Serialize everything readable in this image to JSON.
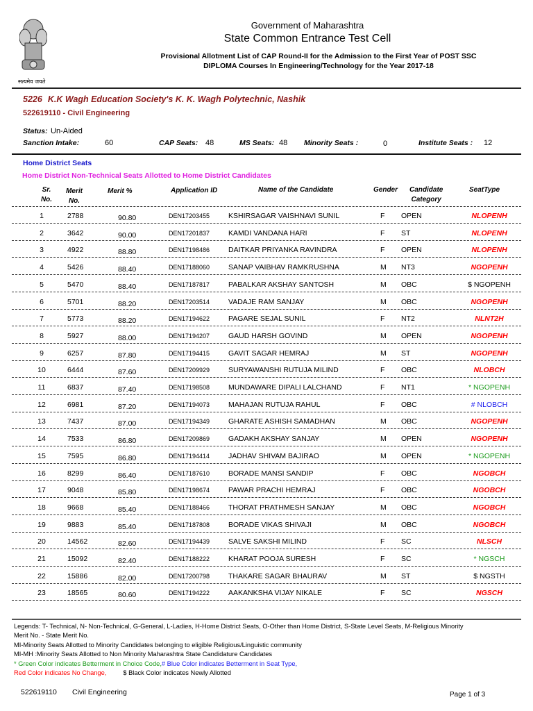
{
  "header": {
    "emblem_motto": "सत्यमेव जयते",
    "government": "Government of Maharashtra",
    "office": "State Common Entrance Test Cell",
    "subtitle_line1": "Provisional Allotment List of CAP Round-II for the Admission to the First Year of POST SSC",
    "subtitle_line2": "DIPLOMA Courses In Engineering/Technology for the Year 2017-18"
  },
  "institute": {
    "code": "5226",
    "name": "K.K Wagh Education Society's K. K. Wagh Polytechnic, Nashik",
    "course": "522619110 - Civil Engineering",
    "status_label": "Status:",
    "status": "Un-Aided",
    "sanction_label": "Sanction Intake:",
    "sanction": "60",
    "cap_label": "CAP Seats:",
    "cap": "48",
    "ms_label": "MS Seats:",
    "ms": "48",
    "minority_label": "Minority Seats :",
    "minority": "0",
    "institute_label": "Institute Seats :",
    "institute_seats": "12"
  },
  "section": {
    "title": "Home District Seats",
    "subtitle": "Home District Non-Technical Seats Allotted to Home District Candidates"
  },
  "columns": {
    "sr1": "Sr.",
    "sr2": "No.",
    "merit1": "Merit",
    "merit2": "No.",
    "merit_pct": "Merit %",
    "app_id": "Application ID",
    "name": "Name of the Candidate",
    "gender": "Gender",
    "cat1": "Candidate",
    "cat2": "Category",
    "seat_type": "SeatType"
  },
  "colors": {
    "red": "#ff0000",
    "green": "#1a9a1a",
    "blue": "#1a1aee",
    "black": "#000000"
  },
  "rows": [
    {
      "sr": "1",
      "merit": "2788",
      "pct": "90.80",
      "id": "DEN17203455",
      "name": "KSHIRSAGAR VAISHNAVI SUNIL",
      "g": "F",
      "cat": "OPEN",
      "seat": "NLOPENH",
      "c": "red"
    },
    {
      "sr": "2",
      "merit": "3642",
      "pct": "90.00",
      "id": "DEN17201837",
      "name": "KAMDI VANDANA HARI",
      "g": "F",
      "cat": "ST",
      "seat": "NLOPENH",
      "c": "red"
    },
    {
      "sr": "3",
      "merit": "4922",
      "pct": "88.80",
      "id": "DEN17198486",
      "name": "DAITKAR PRIYANKA RAVINDRA",
      "g": "F",
      "cat": "OPEN",
      "seat": "NLOPENH",
      "c": "red"
    },
    {
      "sr": "4",
      "merit": "5426",
      "pct": "88.40",
      "id": "DEN17188060",
      "name": "SANAP VAIBHAV RAMKRUSHNA",
      "g": "M",
      "cat": "NT3",
      "seat": "NGOPENH",
      "c": "red"
    },
    {
      "sr": "5",
      "merit": "5470",
      "pct": "88.40",
      "id": "DEN17187817",
      "name": "PABALKAR AKSHAY SANTOSH",
      "g": "M",
      "cat": "OBC",
      "seat": "$ NGOPENH",
      "c": "black"
    },
    {
      "sr": "6",
      "merit": "5701",
      "pct": "88.20",
      "id": "DEN17203514",
      "name": "VADAJE RAM SANJAY",
      "g": "M",
      "cat": "OBC",
      "seat": "NGOPENH",
      "c": "red"
    },
    {
      "sr": "7",
      "merit": "5773",
      "pct": "88.20",
      "id": "DEN17194622",
      "name": "PAGARE SEJAL SUNIL",
      "g": "F",
      "cat": "NT2",
      "seat": "NLNT2H",
      "c": "red"
    },
    {
      "sr": "8",
      "merit": "5927",
      "pct": "88.00",
      "id": "DEN17194207",
      "name": "GAUD HARSH GOVIND",
      "g": "M",
      "cat": "OPEN",
      "seat": "NGOPENH",
      "c": "red"
    },
    {
      "sr": "9",
      "merit": "6257",
      "pct": "87.80",
      "id": "DEN17194415",
      "name": "GAVIT SAGAR HEMRAJ",
      "g": "M",
      "cat": "ST",
      "seat": "NGOPENH",
      "c": "red"
    },
    {
      "sr": "10",
      "merit": "6444",
      "pct": "87.60",
      "id": "DEN17209929",
      "name": "SURYAWANSHI RUTUJA MILIND",
      "g": "F",
      "cat": "OBC",
      "seat": "NLOBCH",
      "c": "red"
    },
    {
      "sr": "11",
      "merit": "6837",
      "pct": "87.40",
      "id": "DEN17198508",
      "name": "MUNDAWARE DIPALI LALCHAND",
      "g": "F",
      "cat": "NT1",
      "seat": "* NGOPENH",
      "c": "green"
    },
    {
      "sr": "12",
      "merit": "6981",
      "pct": "87.20",
      "id": "DEN17194073",
      "name": "MAHAJAN RUTUJA RAHUL",
      "g": "F",
      "cat": "OBC",
      "seat": "# NLOBCH",
      "c": "blue"
    },
    {
      "sr": "13",
      "merit": "7437",
      "pct": "87.00",
      "id": "DEN17194349",
      "name": "GHARATE ASHISH SAMADHAN",
      "g": "M",
      "cat": "OBC",
      "seat": "NGOPENH",
      "c": "red"
    },
    {
      "sr": "14",
      "merit": "7533",
      "pct": "86.80",
      "id": "DEN17209869",
      "name": "GADAKH AKSHAY SANJAY",
      "g": "M",
      "cat": "OPEN",
      "seat": "NGOPENH",
      "c": "red"
    },
    {
      "sr": "15",
      "merit": "7595",
      "pct": "86.80",
      "id": "DEN17194414",
      "name": "JADHAV SHIVAM BAJIRAO",
      "g": "M",
      "cat": "OPEN",
      "seat": "* NGOPENH",
      "c": "green"
    },
    {
      "sr": "16",
      "merit": "8299",
      "pct": "86.40",
      "id": "DEN17187610",
      "name": "BORADE MANSI SANDIP",
      "g": "F",
      "cat": "OBC",
      "seat": "NGOBCH",
      "c": "red"
    },
    {
      "sr": "17",
      "merit": "9048",
      "pct": "85.80",
      "id": "DEN17198674",
      "name": "PAWAR PRACHI HEMRAJ",
      "g": "F",
      "cat": "OBC",
      "seat": "NGOBCH",
      "c": "red"
    },
    {
      "sr": "18",
      "merit": "9668",
      "pct": "85.40",
      "id": "DEN17188466",
      "name": "THORAT PRATHMESH SANJAY",
      "g": "M",
      "cat": "OBC",
      "seat": "NGOBCH",
      "c": "red"
    },
    {
      "sr": "19",
      "merit": "9883",
      "pct": "85.40",
      "id": "DEN17187808",
      "name": "BORADE VIKAS SHIVAJI",
      "g": "M",
      "cat": "OBC",
      "seat": "NGOBCH",
      "c": "red"
    },
    {
      "sr": "20",
      "merit": "14562",
      "pct": "82.60",
      "id": "DEN17194439",
      "name": "SALVE SAKSHI MILIND",
      "g": "F",
      "cat": "SC",
      "seat": "NLSCH",
      "c": "red"
    },
    {
      "sr": "21",
      "merit": "15092",
      "pct": "82.40",
      "id": "DEN17188222",
      "name": "KHARAT POOJA SURESH",
      "g": "F",
      "cat": "SC",
      "seat": "* NGSCH",
      "c": "green"
    },
    {
      "sr": "22",
      "merit": "15886",
      "pct": "82.00",
      "id": "DEN17200798",
      "name": "THAKARE SAGAR BHAURAV",
      "g": "M",
      "cat": "ST",
      "seat": "$ NGSTH",
      "c": "black"
    },
    {
      "sr": "23",
      "merit": "18565",
      "pct": "80.60",
      "id": "DEN17194222",
      "name": "AAKANKSHA VIJAY NIKALE",
      "g": "F",
      "cat": "SC",
      "seat": "NGSCH",
      "c": "red"
    }
  ],
  "legend": {
    "line1": "Legends: T- Technical, N- Non-Technical, G-General, L-Ladies, H-Home District Seats, O-Other than Home District, S-State Level Seats, M-Religious Minority",
    "line2": "Merit No. - State Merit No.",
    "line3": "MI-Minority Seats Allotted to Minority Candidates belonging to eligible Religious/Linguistic community",
    "line4": "MI-MH :Minority Seats Allotted to Non Minority Maharashtra State Candidature Candidates",
    "green": "* Green Color indicates Betterment in Choice Code,",
    "blue": "# Blue Color indicates Betterment in Seat Type,",
    "red": "Red Color indicates No Change,",
    "black": "$ Black Color indicates Newly Allotted"
  },
  "footer": {
    "code": "522619110",
    "course": "Civil Engineering",
    "page": "Page 1 of 3"
  }
}
